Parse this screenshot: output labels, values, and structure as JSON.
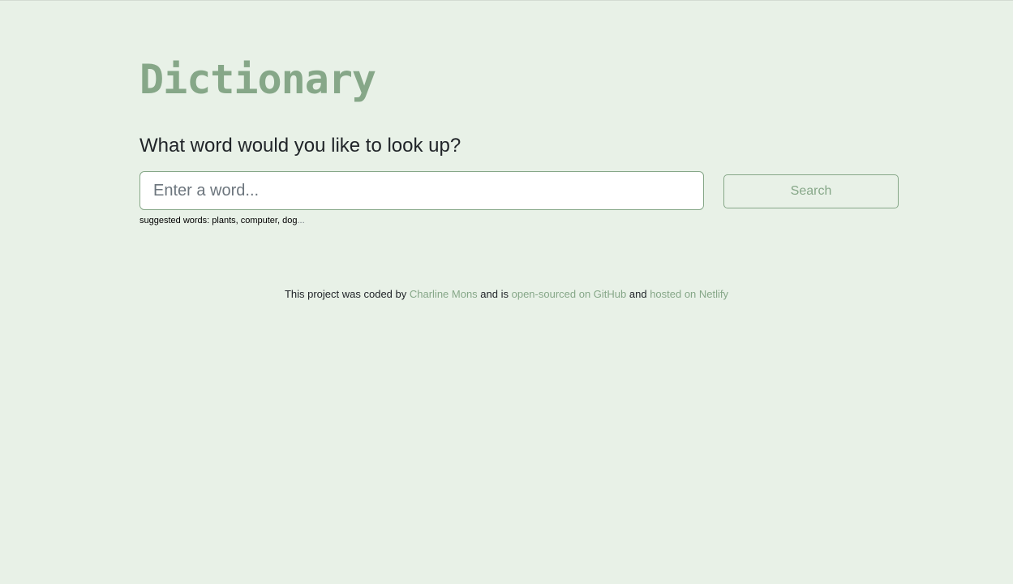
{
  "header": {
    "logo_text": "Dictionary"
  },
  "search": {
    "question": "What word would you like to look up?",
    "placeholder": "Enter a word...",
    "value": "",
    "button_label": "Search",
    "suggested_prefix": "suggested words: plants, computer, dog",
    "suggested_ellipsis": "..."
  },
  "footer": {
    "text_1": "This project was coded by ",
    "author_link": "Charline Mons",
    "text_2": " and is ",
    "github_link": "open-sourced on GitHub",
    "text_3": " and ",
    "netlify_link": "hosted on Netlify"
  },
  "colors": {
    "background": "#e8f1e7",
    "accent": "#86a788",
    "text": "#212529"
  }
}
